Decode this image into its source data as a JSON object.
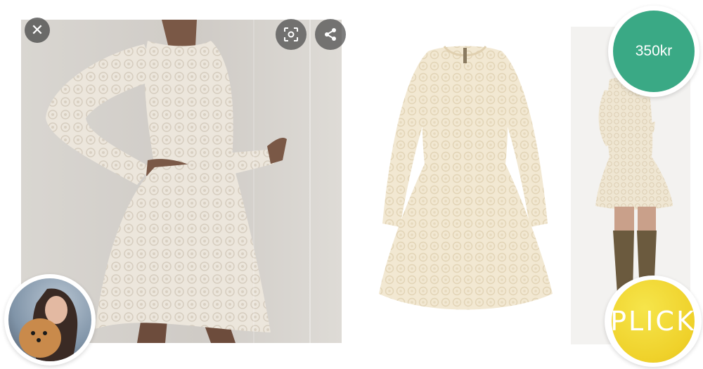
{
  "viewer": {
    "close_icon": "close-icon",
    "lens_icon": "lens-icon",
    "share_icon": "share-icon"
  },
  "listing": {
    "price": "350kr",
    "brand_button": "PLICK"
  },
  "colors": {
    "price_green": "#3aa985",
    "plick_yellow": "#efd12a",
    "lace_cream": "#f2e8d2",
    "wall_gray": "#d3cfca"
  }
}
